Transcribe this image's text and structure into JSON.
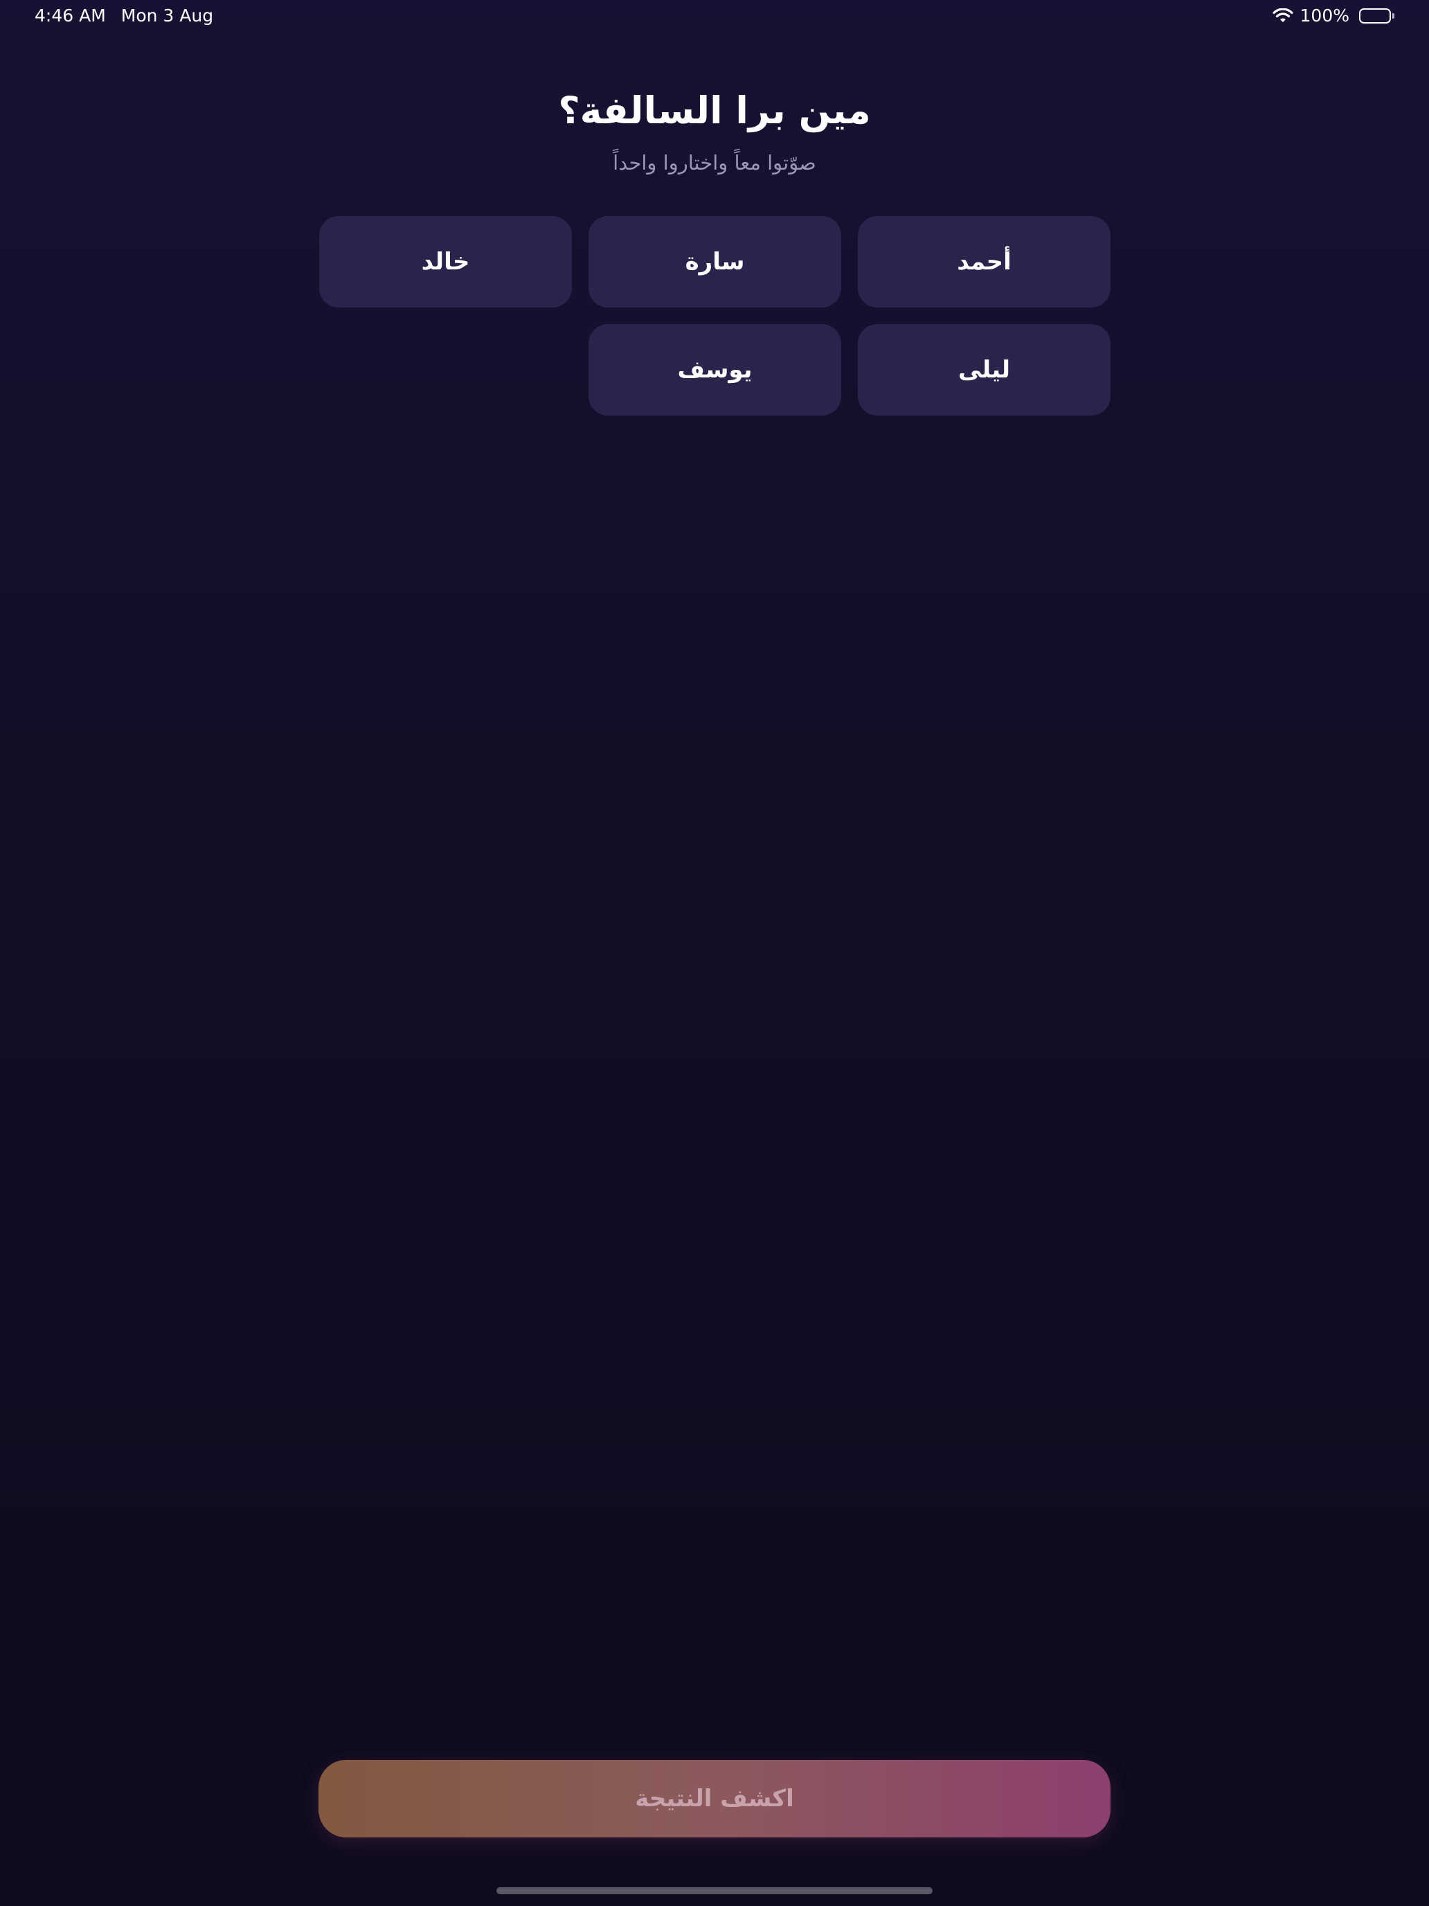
{
  "status_bar": {
    "time": "4:46 AM",
    "date": "Mon 3 Aug",
    "battery": "100%",
    "battery_level": 1.0,
    "icons": [
      "wifi-icon",
      "battery-icon"
    ]
  },
  "header": {
    "title": "مين برا السالفة؟",
    "subtitle": "صوّتوا معاً واختاروا واحداً"
  },
  "players": [
    {
      "name": "أحمد"
    },
    {
      "name": "سارة"
    },
    {
      "name": "خالد"
    },
    {
      "name": "ليلى"
    },
    {
      "name": "يوسف"
    }
  ],
  "reveal_button": {
    "label": "اكشف النتيجة",
    "enabled": false
  },
  "colors": {
    "background": "#141030",
    "card": "#29244b",
    "button_gradient_start": "#835941",
    "button_gradient_end": "#8d3f6e",
    "subtitle_text": "#9a97b3"
  }
}
